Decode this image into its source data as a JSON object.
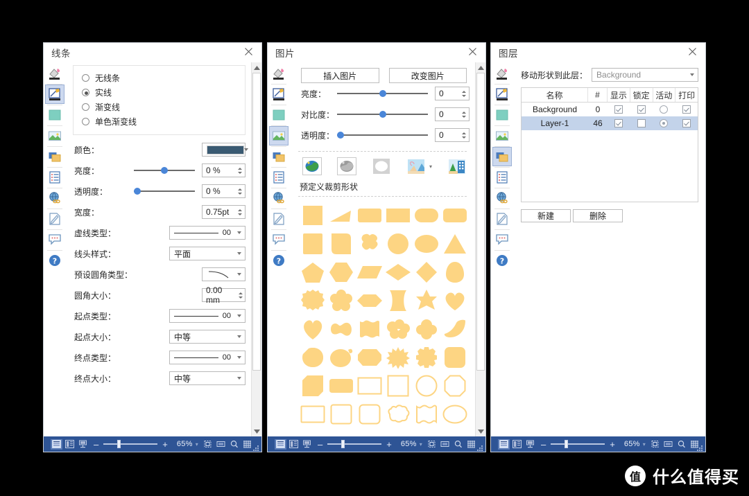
{
  "colors": {
    "statusbar_bg": "#2e5495",
    "selection": "#cdd9ef",
    "shape_fill": "#fdd583",
    "line_color_swatch": "#3a5a72",
    "slider_handle": "#4a86d8",
    "table_row_selected": "#c3d3ea",
    "page_background": "#000000"
  },
  "rail": {
    "icons": [
      {
        "name": "fill-color-icon",
        "label": "填充"
      },
      {
        "name": "line-style-icon",
        "label": "线条"
      },
      {
        "name": "color-swatch-icon",
        "label": "颜色"
      },
      {
        "name": "picture-icon",
        "label": "图片"
      },
      {
        "name": "layers-icon",
        "label": "图层"
      },
      {
        "name": "document-list-icon",
        "label": "文档"
      },
      {
        "name": "hyperlink-globe-icon",
        "label": "超链接"
      },
      {
        "name": "edit-note-icon",
        "label": "编辑"
      },
      {
        "name": "comment-icon",
        "label": "注释"
      },
      {
        "name": "help-icon",
        "label": "帮助"
      }
    ]
  },
  "panel_line": {
    "title": "线条",
    "selected_rail_index": 1,
    "close_label": "×",
    "line_type_options": [
      {
        "label": "无线条",
        "selected": false
      },
      {
        "label": "实线",
        "selected": true
      },
      {
        "label": "渐变线",
        "selected": false
      },
      {
        "label": "单色渐变线",
        "selected": false
      }
    ],
    "fields": [
      {
        "name": "color",
        "label": "颜色：",
        "type": "color",
        "value": "#3a5a72"
      },
      {
        "name": "brightness",
        "label": "亮度：",
        "type": "slider-spin",
        "value": "0 %",
        "slider_pct": 50
      },
      {
        "name": "transparency",
        "label": "透明度：",
        "type": "slider-spin",
        "value": "0 %",
        "slider_pct": 0
      },
      {
        "name": "width",
        "label": "宽度：",
        "type": "spin",
        "value": "0.75pt"
      },
      {
        "name": "dash_type",
        "label": "虚线类型：",
        "type": "line-combo",
        "value": "00"
      },
      {
        "name": "cap_style",
        "label": "线头样式：",
        "type": "combo",
        "value": "平面"
      },
      {
        "name": "corner_preset",
        "label": "预设圆角类型：",
        "type": "curve-combo",
        "value": ""
      },
      {
        "name": "corner_size",
        "label": "圆角大小：",
        "type": "spin",
        "value": "0.00 mm"
      },
      {
        "name": "start_type",
        "label": "起点类型：",
        "type": "line-combo",
        "value": "00"
      },
      {
        "name": "start_size",
        "label": "起点大小：",
        "type": "combo",
        "value": "中等"
      },
      {
        "name": "end_type",
        "label": "终点类型：",
        "type": "line-combo",
        "value": "00"
      },
      {
        "name": "end_size",
        "label": "终点大小：",
        "type": "combo",
        "value": "中等"
      }
    ],
    "statusbar": {
      "zoom": "65%",
      "minus": "–",
      "plus": "+"
    }
  },
  "panel_picture": {
    "title": "图片",
    "selected_rail_index": 3,
    "buttons": [
      {
        "name": "insert-picture-button",
        "label": "插入图片"
      },
      {
        "name": "change-picture-button",
        "label": "改变图片"
      }
    ],
    "fields": [
      {
        "name": "brightness",
        "label": "亮度：",
        "value": "0",
        "slider_pct": 50
      },
      {
        "name": "contrast",
        "label": "对比度：",
        "value": "0",
        "slider_pct": 50
      },
      {
        "name": "transparency",
        "label": "透明度：",
        "value": "0",
        "slider_pct": 0
      }
    ],
    "effects": [
      {
        "name": "original-color-effect",
        "selected": true
      },
      {
        "name": "grayscale-effect",
        "selected": false
      },
      {
        "name": "blackwhite-effect",
        "selected": false
      },
      {
        "name": "watermark-effect",
        "selected": false,
        "has_dropdown": true
      },
      {
        "name": "crop-effect",
        "selected": false
      }
    ],
    "crop_section_label": "预定义裁剪形状",
    "shapes": [
      "square",
      "right-triangle",
      "rounded-rect",
      "rectangle",
      "stadium",
      "rounded-rect-2",
      "square-2",
      "rounded-square",
      "four-lobe-blob",
      "circle",
      "ellipse",
      "triangle",
      "pentagon",
      "hexagon",
      "parallelogram",
      "wide-diamond",
      "diamond",
      "egg",
      "scallop-circle",
      "flower",
      "elongated-hexagon",
      "bowtie-rect",
      "six-point-star",
      "heart",
      "heart-2",
      "peanut",
      "framed-rect",
      "cloud",
      "cloud-round",
      "teardrop",
      "leaf",
      "lemon",
      "octagon-soft",
      "starburst",
      "gear",
      "rounded-square-3",
      "cut-corner-square",
      "tag",
      "rect-outline",
      "square-outline",
      "circle-outline",
      "octagon-outline",
      "rect-outline-2",
      "square-outline-2",
      "rounded-rect-outline",
      "blob-outline",
      "pillow-outline",
      "ellipse-outline"
    ],
    "statusbar": {
      "zoom": "65%",
      "minus": "–",
      "plus": "+"
    }
  },
  "panel_layer": {
    "title": "图层",
    "selected_rail_index": 4,
    "move_label": "移动形状到此层：",
    "move_value": "Background",
    "table": {
      "headers": [
        "名称",
        "#",
        "显示",
        "锁定",
        "活动",
        "打印"
      ],
      "rows": [
        {
          "name": "Background",
          "num": "0",
          "show": true,
          "lock": true,
          "active": false,
          "print": true,
          "selected": false
        },
        {
          "name": "Layer-1",
          "num": "46",
          "show": true,
          "lock": false,
          "active": true,
          "print": true,
          "selected": true
        }
      ]
    },
    "buttons": [
      {
        "name": "new-layer-button",
        "label": "新建"
      },
      {
        "name": "delete-layer-button",
        "label": "删除"
      }
    ],
    "statusbar": {
      "zoom": "65%",
      "minus": "–",
      "plus": "+"
    }
  },
  "statusbar_icons": [
    {
      "name": "single-page-view-icon",
      "active": true
    },
    {
      "name": "facing-page-view-icon",
      "active": false
    },
    {
      "name": "book-view-icon",
      "active": false
    }
  ],
  "statusbar_right_icons": [
    {
      "name": "fit-page-icon"
    },
    {
      "name": "fit-width-icon"
    },
    {
      "name": "zoom-select-icon"
    },
    {
      "name": "grid-icon"
    }
  ],
  "watermark": {
    "badge": "值",
    "text": "什么值得买"
  }
}
